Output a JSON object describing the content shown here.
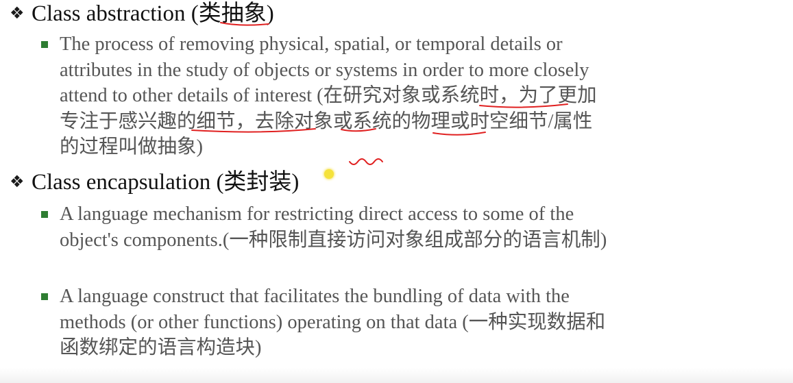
{
  "sections": [
    {
      "title": "Class abstraction (类抽象)",
      "bullets": [
        {
          "text": "The process of removing physical, spatial, or temporal details or attributes in the study of objects or systems in order to more closely attend to other details of interest (在研究对象或系统时，为了更加专注于感兴趣的细节，去除对象或系统的物理或时空细节/属性的过程叫做抽象)"
        }
      ]
    },
    {
      "title": "Class encapsulation (类封装)",
      "bullets": [
        {
          "text": "A language mechanism for restricting direct access to some of the object's components.(一种限制直接访问对象组成部分的语言机制)"
        },
        {
          "text": "A language construct that facilitates the bundling of data with the methods (or other functions) operating on that data (一种实现数据和函数绑定的语言构造块)"
        }
      ]
    }
  ],
  "colors": {
    "heading": "#111111",
    "body_text": "#555555",
    "bullet_marker": "#2e7d32",
    "annotation_ink": "#e02020",
    "pointer": "#f5e23a"
  },
  "icons": {
    "heading_marker": "diamond-dots-icon",
    "bullet_marker": "square-bullet-icon"
  }
}
